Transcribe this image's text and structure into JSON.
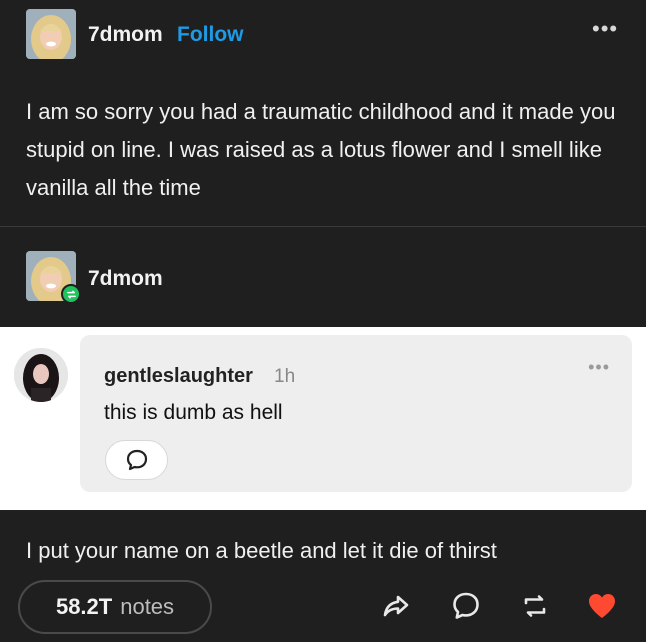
{
  "op_post": {
    "username": "7dmom",
    "follow_label": "Follow",
    "menu_icon": "more-dots-icon",
    "text": "I am so sorry you had a traumatic childhood and it made you stupid on line. I was raised as a lotus flower and I smell like vanilla all the time"
  },
  "reblog": {
    "username": "7dmom",
    "badge_icon": "reblog-icon",
    "badge_color": "#1fc45e"
  },
  "comment": {
    "author": "gentleslaughter",
    "time": "1h",
    "text": "this is dumb as hell",
    "menu_icon": "more-dots-icon",
    "reply_icon": "speech-bubble-icon"
  },
  "reply_text": "I put your name on a beetle and let it die of thirst",
  "footer": {
    "notes_count": "58.2T",
    "notes_label": "notes",
    "actions": [
      "share-icon",
      "comment-icon",
      "reblog-icon",
      "heart-icon"
    ],
    "heart_color": "#ff4930",
    "link_color": "#1e9be6"
  }
}
